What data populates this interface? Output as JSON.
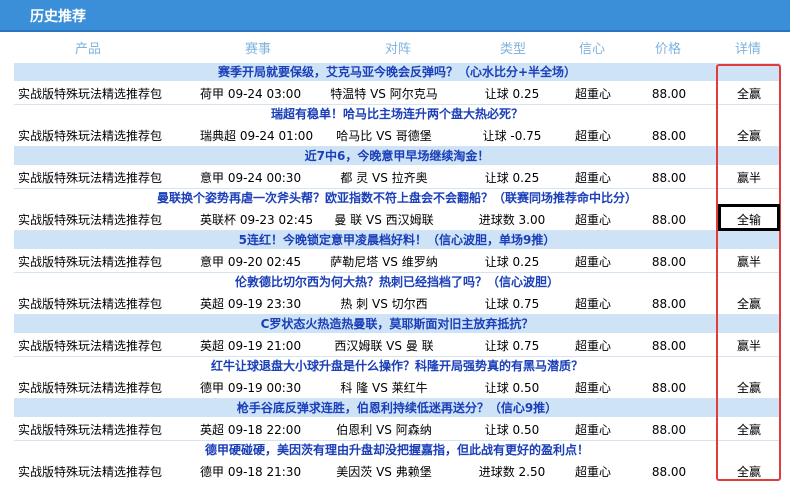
{
  "title": "历史推荐",
  "columns": [
    "产品",
    "赛事",
    "对阵",
    "类型",
    "信心",
    "价格",
    "详情"
  ],
  "rows": [
    {
      "question": "赛季开局就要保级，艾克马亚今晚会反弹吗？（心水比分+半全场）",
      "product": "实战版特殊玩法精选推荐包",
      "match": "荷甲 09-24 03:00",
      "vs": "特温特 VS 阿尔克马",
      "type": "让球 0.25",
      "confidence": "超重心",
      "price": "88.00",
      "result": "全赢"
    },
    {
      "question": "瑞超有稳单！哈马比主场连升两个盘大热必死？",
      "product": "实战版特殊玩法精选推荐包",
      "match": "瑞典超 09-24 01:00",
      "vs": "哈马比 VS 哥德堡",
      "type": "让球 -0.75",
      "confidence": "超重心",
      "price": "88.00",
      "result": "全赢"
    },
    {
      "question": "近7中6，今晚意甲早场继续淘金！",
      "product": "实战版特殊玩法精选推荐包",
      "match": "意甲 09-24 00:30",
      "vs": "都 灵 VS 拉齐奥",
      "type": "让球 0.25",
      "confidence": "超重心",
      "price": "88.00",
      "result": "赢半"
    },
    {
      "question": "曼联换个姿势再虐一次斧头帮？欧亚指数不符上盘会不会翻船？（联赛同场推荐命中比分）",
      "product": "实战版特殊玩法精选推荐包",
      "match": "英联杯 09-23 02:45",
      "vs": "曼 联 VS 西汉姆联",
      "type": "进球数 3.00",
      "confidence": "超重心",
      "price": "88.00",
      "result": "全输"
    },
    {
      "question": "5连红！今晚锁定意甲凌晨档好料！（信心波胆，单场9推）",
      "product": "实战版特殊玩法精选推荐包",
      "match": "意甲 09-20 02:45",
      "vs": "萨勒尼塔 VS 维罗纳",
      "type": "让球 0.25",
      "confidence": "超重心",
      "price": "88.00",
      "result": "赢半"
    },
    {
      "question": "伦敦德比切尔西为何大热？热刺已经挡档了吗？（信心波胆）",
      "product": "实战版特殊玩法精选推荐包",
      "match": "英超 09-19 23:30",
      "vs": "热 刺 VS 切尔西",
      "type": "让球 0.75",
      "confidence": "超重心",
      "price": "88.00",
      "result": "全赢"
    },
    {
      "question": "C罗状态火热造热曼联，莫耶斯面对旧主放弃抵抗？",
      "product": "实战版特殊玩法精选推荐包",
      "match": "英超 09-19 21:00",
      "vs": "西汉姆联 VS 曼 联",
      "type": "让球 0.75",
      "confidence": "超重心",
      "price": "88.00",
      "result": "赢半"
    },
    {
      "question": "红牛让球退盘大小球升盘是什么操作？科隆开局强势真的有黑马潜质？",
      "product": "实战版特殊玩法精选推荐包",
      "match": "德甲 09-19 00:30",
      "vs": "科 隆 VS 莱红牛",
      "type": "让球 0.50",
      "confidence": "超重心",
      "price": "88.00",
      "result": "全赢"
    },
    {
      "question": "枪手谷底反弹求连胜，伯恩利持续低迷再送分？（信心9推）",
      "product": "实战版特殊玩法精选推荐包",
      "match": "英超 09-18 22:00",
      "vs": "伯恩利 VS 阿森纳",
      "type": "让球 0.50",
      "confidence": "超重心",
      "price": "88.00",
      "result": "全赢"
    },
    {
      "question": "德甲硬碰硬，美因茨有理由升盘却没把握嘉指，但此战有更好的盈利点！",
      "product": "实战版特殊玩法精选推荐包",
      "match": "德甲 09-18 21:30",
      "vs": "美因茨 VS 弗赖堡",
      "type": "进球数 2.50",
      "confidence": "超重心",
      "price": "88.00",
      "result": "全赢"
    }
  ]
}
